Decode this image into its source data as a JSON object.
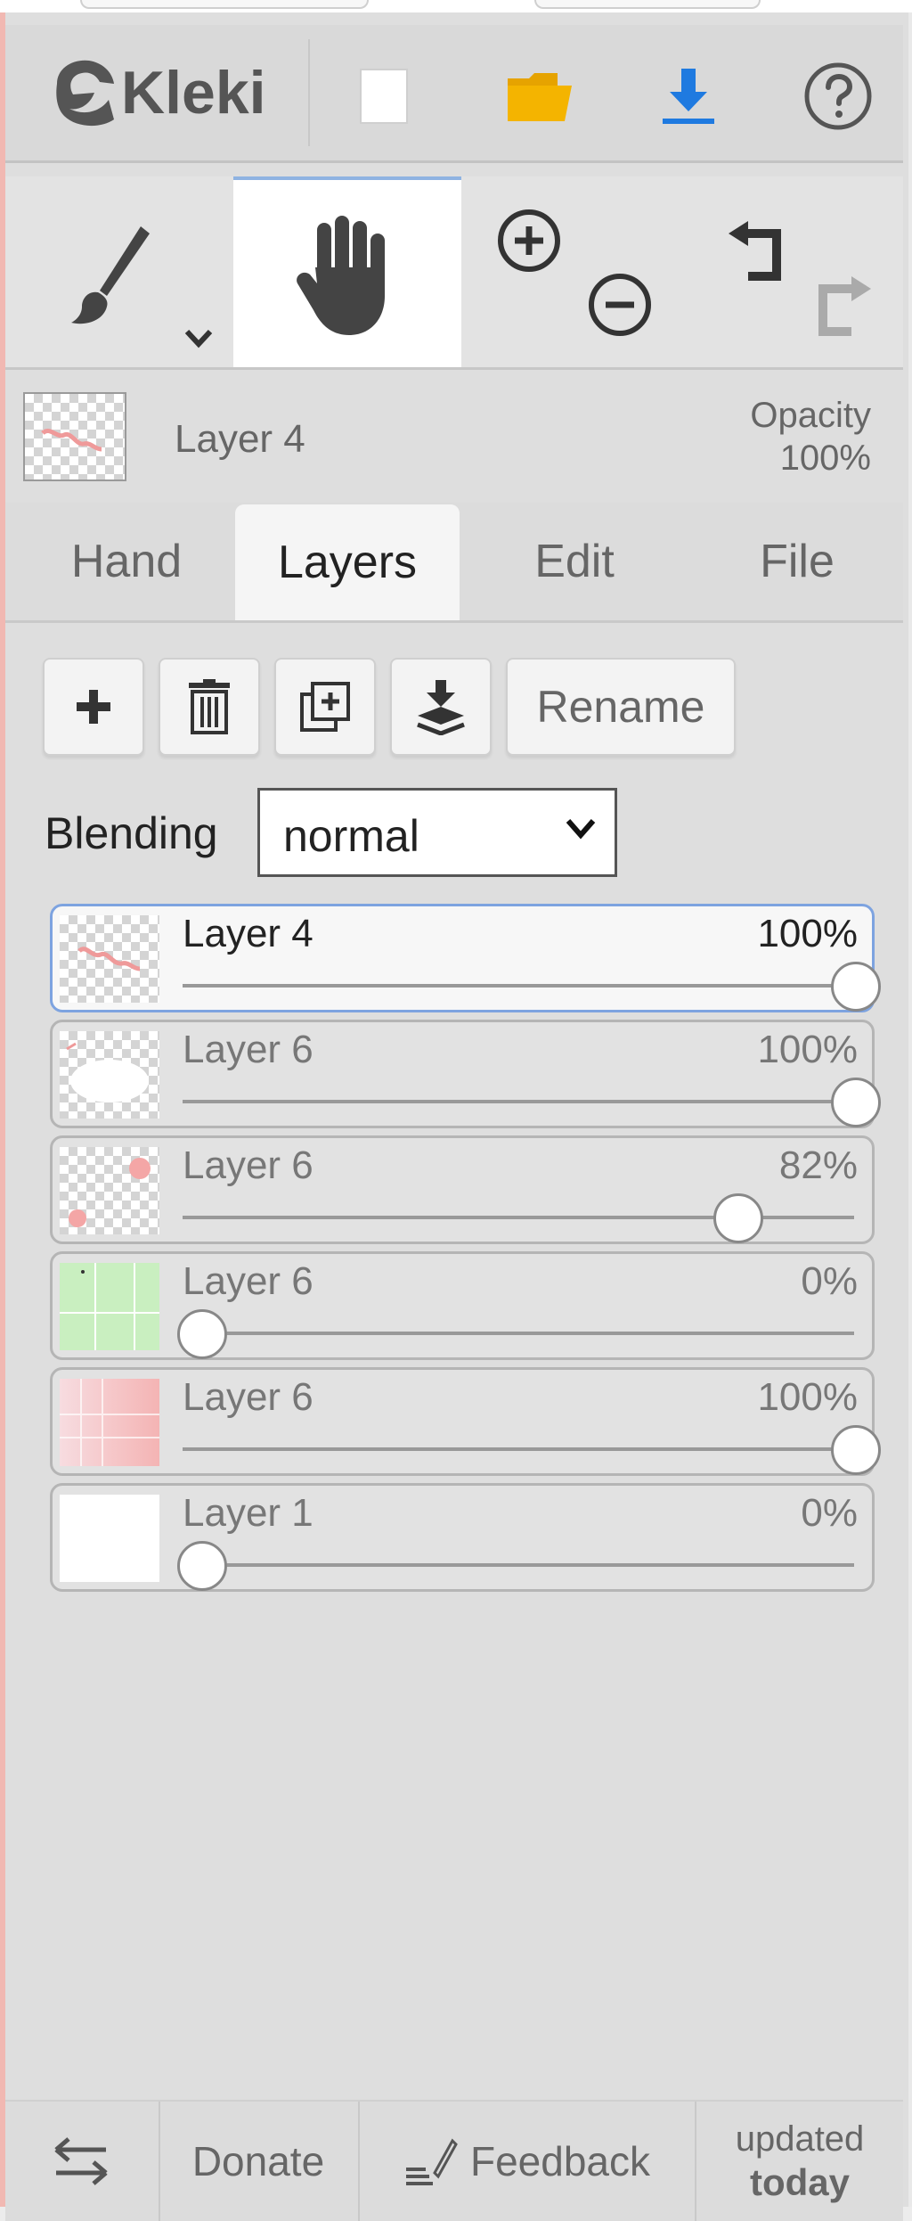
{
  "app": {
    "logo_text": "Kleki"
  },
  "info": {
    "layer_name": "Layer 4",
    "opacity_label": "Opacity",
    "opacity_value": "100%"
  },
  "tabs": [
    {
      "label": "Hand",
      "active": false
    },
    {
      "label": "Layers",
      "active": true
    },
    {
      "label": "Edit",
      "active": false
    },
    {
      "label": "File",
      "active": false
    }
  ],
  "layer_tools": {
    "rename_label": "Rename"
  },
  "blending": {
    "label": "Blending",
    "value": "normal"
  },
  "layers": [
    {
      "name": "Layer 4",
      "opacity_label": "100%",
      "opacity": 1.0,
      "selected": true
    },
    {
      "name": "Layer 6",
      "opacity_label": "100%",
      "opacity": 1.0,
      "selected": false
    },
    {
      "name": "Layer 6",
      "opacity_label": "82%",
      "opacity": 0.82,
      "selected": false
    },
    {
      "name": "Layer 6",
      "opacity_label": "0%",
      "opacity": 0.0,
      "selected": false
    },
    {
      "name": "Layer 6",
      "opacity_label": "100%",
      "opacity": 1.0,
      "selected": false
    },
    {
      "name": "Layer 1",
      "opacity_label": "0%",
      "opacity": 0.0,
      "selected": false
    }
  ],
  "footer": {
    "donate_label": "Donate",
    "feedback_label": "Feedback",
    "updated_line1": "updated",
    "updated_line2": "today"
  },
  "colors": {
    "accent": "#1f7ae0",
    "folder": "#f4b400",
    "selected_border": "#7da3e0",
    "panel_bg": "#dedede"
  }
}
